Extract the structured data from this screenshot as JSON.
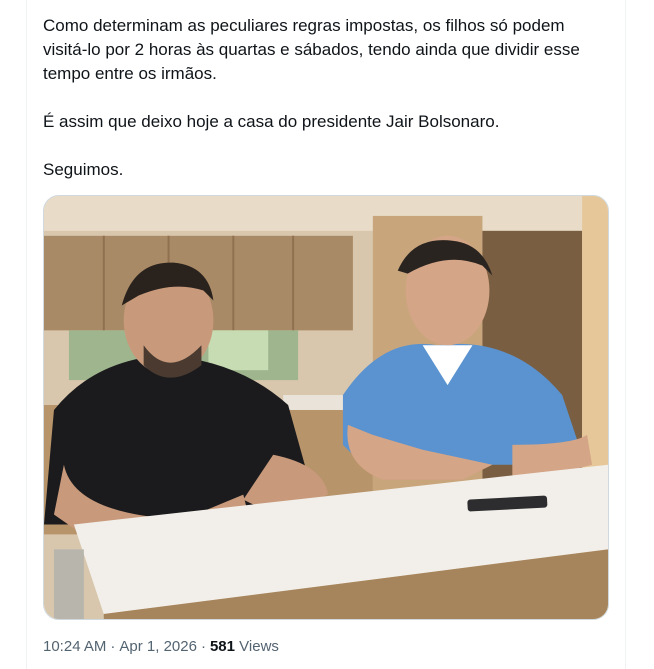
{
  "tweet": {
    "text_lines": [
      "Como determinam as peculiares regras impostas, os filhos só podem",
      "visitá-lo por 2 horas às quartas e sábados, tendo ainda que dividir esse",
      "tempo entre os irmãos.",
      "É assim que deixo hoje a casa do presidente Jair Bolsonaro.",
      "Seguimos."
    ],
    "media": {
      "kind": "photo"
    },
    "meta": {
      "time": "10:24 AM",
      "separator": "·",
      "date": "Apr 1, 2026",
      "views_count": "581",
      "views_label": "Views"
    }
  },
  "colors": {
    "text": "#0f1419",
    "secondary": "#536471",
    "border": "#cfd9de"
  }
}
